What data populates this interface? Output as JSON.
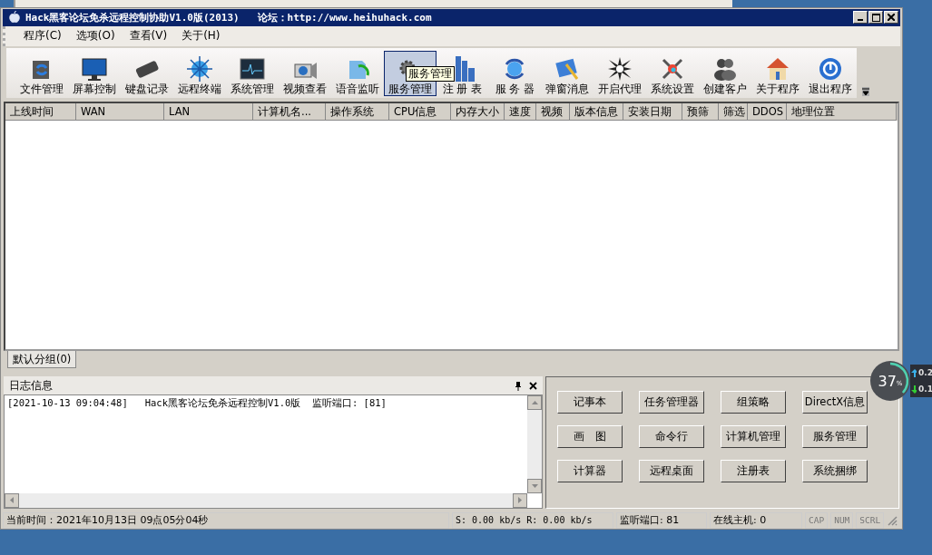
{
  "window": {
    "title": "Hack黑客论坛免杀远程控制协助V1.0版(2013)   论坛：http://www.heihuhack.com"
  },
  "menu": [
    "程序(C)",
    "选项(O)",
    "查看(V)",
    "关于(H)"
  ],
  "toolbar": [
    {
      "label": "文件管理",
      "selected": false
    },
    {
      "label": "屏幕控制",
      "selected": false
    },
    {
      "label": "键盘记录",
      "selected": false
    },
    {
      "label": "远程终端",
      "selected": false
    },
    {
      "label": "系统管理",
      "selected": false
    },
    {
      "label": "视频查看",
      "selected": false
    },
    {
      "label": "语音监听",
      "selected": false
    },
    {
      "label": "服务管理",
      "selected": true
    },
    {
      "label": "注 册 表",
      "selected": false
    },
    {
      "label": "服 务 器",
      "selected": false
    },
    {
      "label": "弹窗消息",
      "selected": false
    },
    {
      "label": "开启代理",
      "selected": false
    },
    {
      "label": "系统设置",
      "selected": false
    },
    {
      "label": "创建客户",
      "selected": false
    },
    {
      "label": "关于程序",
      "selected": false
    },
    {
      "label": "退出程序",
      "selected": false
    }
  ],
  "tooltip": "服务管理",
  "table": {
    "columns": [
      "上线时间",
      "WAN",
      "LAN",
      "计算机名...",
      "操作系统",
      "CPU信息",
      "内存大小",
      "速度",
      "视频",
      "版本信息",
      "安装日期",
      "预筛",
      "筛选",
      "DDOS",
      "地理位置"
    ]
  },
  "group_tabs": [
    {
      "label": "默认分组(0)",
      "selected": true
    }
  ],
  "log": {
    "title": "日志信息",
    "lines": [
      "[2021-10-13 09:04:48]   Hack黑客论坛免杀远程控制V1.0版  监听端口: [81]"
    ]
  },
  "tools": [
    "记事本",
    "任务管理器",
    "组策略",
    "DirectX信息",
    "画　图",
    "命令行",
    "计算机管理",
    "服务管理",
    "计算器",
    "远程桌面",
    "注册表",
    "系统捆绑"
  ],
  "status_bar": {
    "time": "当前时间：2021年10月13日 09点05分04秒",
    "speed": "S: 0.00 kb/s R: 0.00 kb/s",
    "port": "监听端口: 81",
    "online": "在线主机: 0",
    "keys": [
      {
        "label": "CAP",
        "on": false
      },
      {
        "label": "NUM",
        "on": false
      },
      {
        "label": "SCRL",
        "on": false
      }
    ]
  },
  "net_meter": {
    "percent": "37",
    "unit": "%",
    "level": 0.37,
    "up": "0.2",
    "down": "0.1"
  }
}
